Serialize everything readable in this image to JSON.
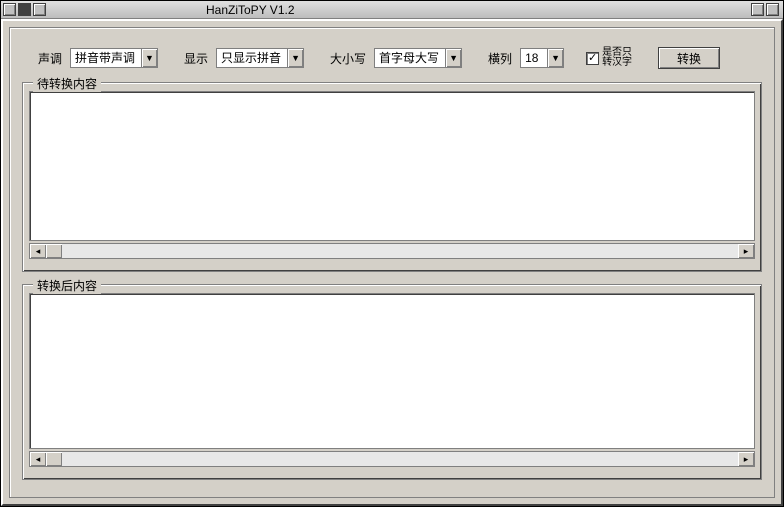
{
  "window": {
    "title": "HanZiToPY  V1.2"
  },
  "toolbar": {
    "tone_label": "声调",
    "tone_value": "拼音带声调",
    "display_label": "显示",
    "display_value": "只显示拼音",
    "case_label": "大小写",
    "case_value": "首字母大写",
    "cols_label": "横列",
    "cols_value": "18",
    "checkbox_label": "是否只\n转汉字",
    "checkbox_checked": "✓",
    "convert_button": "转换"
  },
  "groups": {
    "input_legend": "待转换内容",
    "output_legend": "转换后内容"
  },
  "content": {
    "input_text": "",
    "output_text": ""
  }
}
